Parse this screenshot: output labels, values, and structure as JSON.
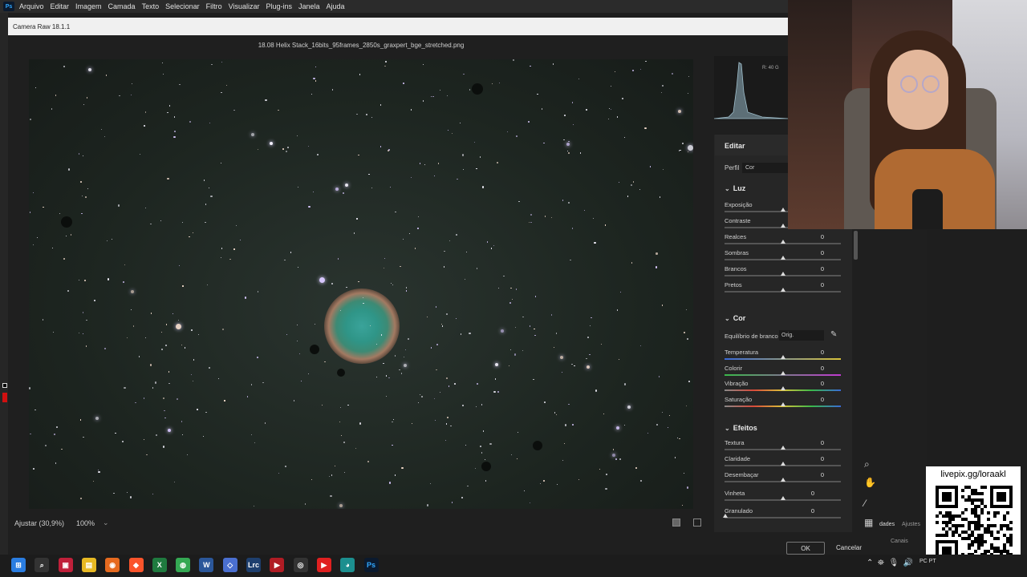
{
  "app": {
    "logo": "Ps",
    "menus": [
      "Arquivo",
      "Editar",
      "Imagem",
      "Camada",
      "Texto",
      "Selecionar",
      "Filtro",
      "Visualizar",
      "Plug-ins",
      "Janela",
      "Ajuda"
    ]
  },
  "dialog": {
    "title": "Camera Raw 18.1.1",
    "filename": "18.08 Helix Stack_16bits_95frames_2850s_graxpert_bge_stretched.png",
    "zoom_label": "Ajustar (30,9%)",
    "zoom_pct": "100%",
    "ok_label": "OK",
    "cancel_label": "Cancelar"
  },
  "histogram": {
    "readout": "R: 40   G"
  },
  "edit_panel": {
    "title": "Editar",
    "perfil_label": "Perfil",
    "perfil_value": "Cor",
    "luz": {
      "title": "Luz",
      "sliders": [
        {
          "label": "Exposição",
          "value": ""
        },
        {
          "label": "Contraste",
          "value": ""
        },
        {
          "label": "Realces",
          "value": "0"
        },
        {
          "label": "Sombras",
          "value": "0"
        },
        {
          "label": "Brancos",
          "value": "0"
        },
        {
          "label": "Pretos",
          "value": "0"
        }
      ]
    },
    "cor": {
      "title": "Cor",
      "wb_label": "Equilíbrio de branco",
      "wb_value": "Orig.",
      "sliders": [
        {
          "label": "Temperatura",
          "value": "0"
        },
        {
          "label": "Colorir",
          "value": "0"
        },
        {
          "label": "Vibração",
          "value": "0"
        },
        {
          "label": "Saturação",
          "value": "0"
        }
      ]
    },
    "efeitos": {
      "title": "Efeitos",
      "sliders": [
        {
          "label": "Textura",
          "value": "0"
        },
        {
          "label": "Claridade",
          "value": "0"
        },
        {
          "label": "Desembaçar",
          "value": "0"
        },
        {
          "label": "Vinheta",
          "value": "0"
        },
        {
          "label": "Granulado",
          "value": "0"
        }
      ]
    }
  },
  "ps_panels": {
    "tab_props": "dades",
    "tab_adj": "Ajustes",
    "tab_channels": "Canais"
  },
  "overlay": {
    "qr_label": "livepix.gg/loraakl"
  },
  "taskbar": {
    "apps": [
      "windows-start",
      "search",
      "media",
      "explorer",
      "firefox",
      "brave",
      "excel",
      "chrome",
      "word",
      "app-diamond",
      "Lrc",
      "video-editor",
      "davinci",
      "youtube",
      "astro",
      "Ps"
    ],
    "clock": "PC\nPT"
  },
  "colors": {
    "accent_ps": "#31a8ff",
    "panel_bg": "#262626",
    "canvas_bg": "#1d2520"
  }
}
